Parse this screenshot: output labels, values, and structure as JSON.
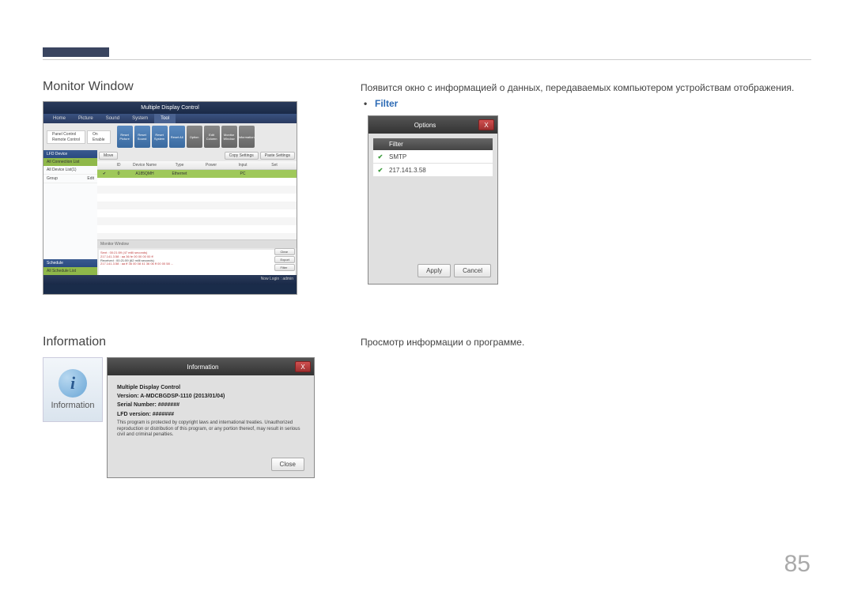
{
  "page_number": "85",
  "sections": {
    "monitor_window": {
      "title": "Monitor Window"
    },
    "information": {
      "title": "Information"
    }
  },
  "body": {
    "monitor_desc": "Появится окно с информацией о данных, передаваемых компьютером устройствам отображения.",
    "info_desc": "Просмотр информации о программе.",
    "filter_label": "Filter"
  },
  "mdc": {
    "title": "Multiple Display Control",
    "tabs": [
      "Home",
      "Picture",
      "Sound",
      "System",
      "Tool"
    ],
    "active_tab": 4,
    "panel_rows": [
      [
        "Panel Control",
        "On"
      ],
      [
        "Remote Control",
        "Enable"
      ]
    ],
    "tool_icons": [
      "Reset Picture",
      "Reset Sound",
      "Reset System",
      "Reset All",
      "Option",
      "Edit Column",
      "Monitor Window",
      "Information"
    ],
    "main_buttons": [
      "Move",
      "Copy Settings",
      "Paste Settings"
    ],
    "sidebar": {
      "lfd_header": "LFD Device",
      "conn_list": "All Connection List",
      "device_list": "All Device List(1)",
      "group": "Group",
      "edit": "Edit",
      "schedule_header": "Schedule",
      "schedule_list": "All Schedule List"
    },
    "grid": {
      "headers": [
        "",
        "ID",
        "Device Name",
        "Type",
        "Power",
        "Input",
        "Set"
      ],
      "row": [
        "✔",
        "0",
        "A185QMH",
        "Ethernet",
        "",
        "PC",
        ""
      ]
    },
    "monitor": {
      "title": "Monitor Window",
      "sent": "Sent : 00:21:59 (47 milli seconds)",
      "ip": "217.141.3.58 : aa 36 fe 00 00 00 00 ff",
      "received": "Received : 00:21:59 (62 milli seconds)",
      "ip2": "217.141.3.58 : aa ff 36 00 08 41 36 06 ff 00 00 58 ...",
      "buttons": [
        "Clear",
        "Export",
        "Filter"
      ]
    },
    "statusbar": "Now Login : admin"
  },
  "options_dialog": {
    "title": "Options",
    "column_header": "Filter",
    "rows": [
      "SMTP",
      "217.141.3.58"
    ],
    "apply": "Apply",
    "cancel": "Cancel",
    "close": "X"
  },
  "info_tile": {
    "label": "Information"
  },
  "info_dialog": {
    "title": "Information",
    "close": "X",
    "product": "Multiple Display Control",
    "version": "Version: A-MDCBGDSP-1110 (2013/01/04)",
    "serial": "Serial Number: #######",
    "lfd": "LFD version: #######",
    "note": "This program is protected by copyright laws and international treaties. Unauthorized reproduction or distribution of this program, or any portion thereof, may result in serious civil and criminal penalties.",
    "close_btn": "Close"
  }
}
